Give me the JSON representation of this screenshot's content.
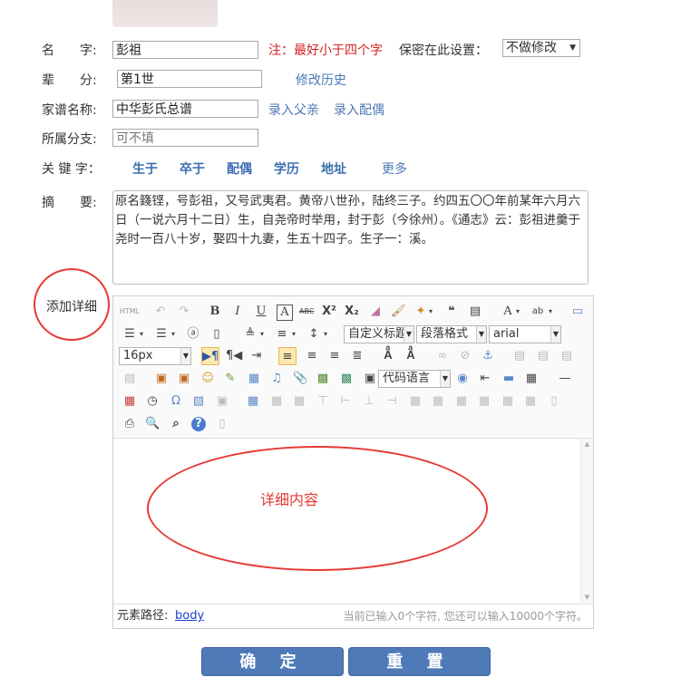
{
  "form": {
    "name_label": "名　　字:",
    "name_value": "彭祖",
    "name_note": "注：最好小于四个字",
    "privacy_label": "保密在此设置：",
    "privacy_value": "不做修改",
    "generation_label": "辈　　分:",
    "generation_value": "第1世",
    "history_link": "修改历史",
    "genealogy_label": "家谱名称:",
    "genealogy_value": "中华彭氏总谱",
    "enter_father": "录入父亲",
    "enter_spouse": "录入配偶",
    "branch_label": "所属分支:",
    "branch_placeholder": "可不填",
    "keywords_label": "关 键 字：",
    "keywords": [
      "生于",
      "卒于",
      "配偶",
      "学历",
      "地址",
      "更多"
    ],
    "summary_label": "摘　　要:",
    "summary_text": "原名籛铿，号彭祖，又号武夷君。黄帝八世孙，陆终三子。约四五〇〇年前某年六月六日（一说六月十二日）生，自尧帝时举用，封于彭（今徐州）。《通志》云：彭祖进羹于尧时一百八十岁，娶四十九妻，生五十四子。生子一：溪。",
    "detail_label": "添加详细"
  },
  "editor": {
    "html_btn": "HTML",
    "custom_title": "自定义标题",
    "paragraph": "段落格式",
    "font": "arial",
    "size": "16px",
    "code_lang": "代码语言",
    "content_note": "详细内容",
    "path_label": "元素路径:",
    "path_value": "body",
    "char_count": "当前已输入0个字符, 您还可以输入10000个字符。"
  },
  "buttons": {
    "confirm": "确 定",
    "reset": "重 置"
  },
  "colors": {
    "accent": "#4f7ab8",
    "link": "#4a78b5",
    "note_red": "#d42020",
    "annotation": "#e53935"
  }
}
